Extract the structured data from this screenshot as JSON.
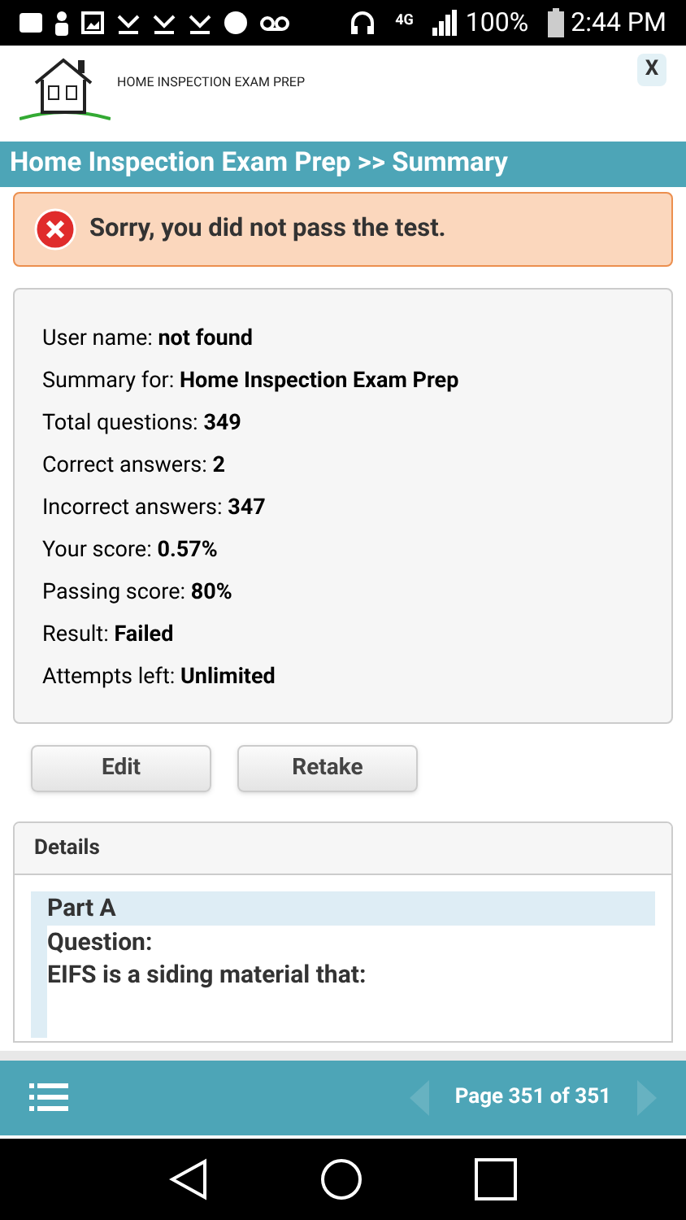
{
  "status_bar": {
    "network": "4G",
    "battery": "100%",
    "time": "2:44 PM"
  },
  "header": {
    "logo_text": "HOME INSPECTION EXAM PREP",
    "close": "X"
  },
  "title_bar": {
    "title": "Home Inspection Exam Prep >> Summary"
  },
  "alert": {
    "message": "Sorry, you did not pass the test."
  },
  "summary": [
    "User name: **not found**",
    "Summary for: **Home Inspection Exam Prep**",
    "Total questions: **349**",
    "Correct answers: **2**",
    "Incorrect answers: **347**",
    "Your score: **0.57%**",
    "Passing score: **80%**",
    "Result: **Failed**",
    "Attempts left: **Unlimited**"
  ],
  "buttons": [
    "Edit",
    "Retake"
  ],
  "details": {
    "title": "Details",
    "part": "Part A",
    "question_label": "Question:",
    "question": "EIFS is a siding material that:"
  },
  "bottom_bar": {
    "page": "Page 351 of 351",
    "prev_disabled": true,
    "next_disabled": true
  }
}
